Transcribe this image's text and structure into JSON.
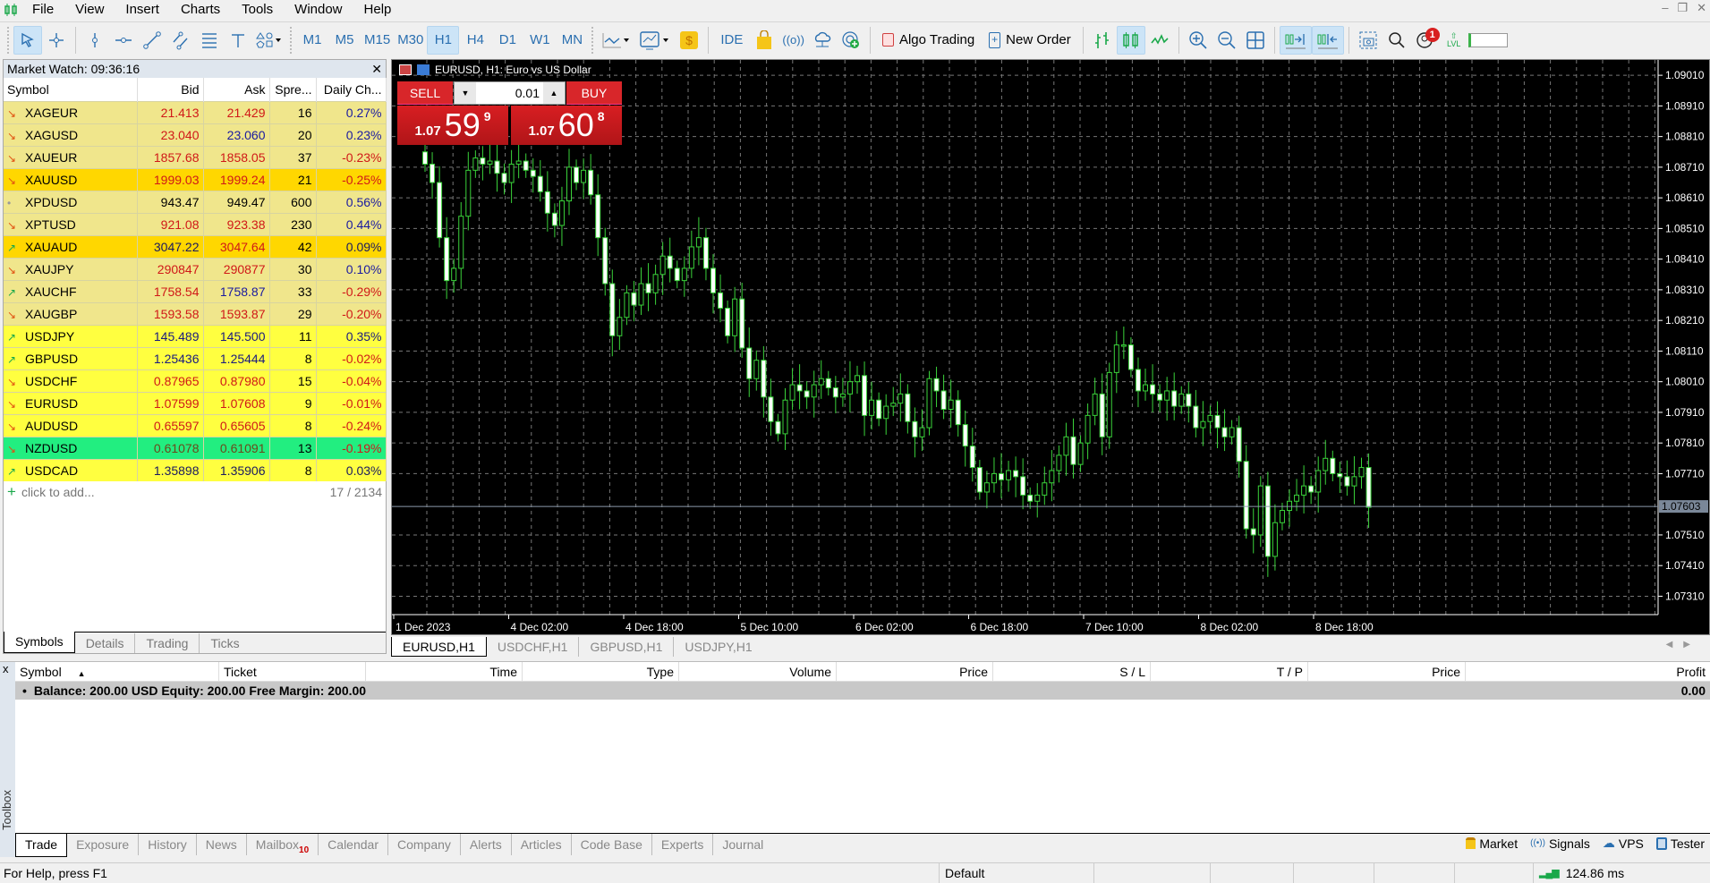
{
  "app": {
    "logo": "candles-logo"
  },
  "menu": [
    "File",
    "View",
    "Insert",
    "Charts",
    "Tools",
    "Window",
    "Help"
  ],
  "window_controls": {
    "minimize": "–",
    "restore": "❐",
    "close": "✕"
  },
  "toolbar": {
    "timeframes": [
      "M1",
      "M5",
      "M15",
      "M30",
      "H1",
      "H4",
      "D1",
      "W1",
      "MN"
    ],
    "active_timeframe": "H1",
    "ide_label": "IDE",
    "algo_trading_label": "Algo Trading",
    "new_order_label": "New Order",
    "notification_count": "1",
    "lvl_label": "LVL"
  },
  "market_watch": {
    "title": "Market Watch: 09:36:16",
    "columns": [
      "Symbol",
      "Bid",
      "Ask",
      "Spre...",
      "Daily Ch..."
    ],
    "rows": [
      {
        "symbol": "XAGEUR",
        "dir": "down",
        "bid": "21.413",
        "ask": "21.429",
        "spread": "16",
        "change": "0.27%",
        "bg": "#f0e68c",
        "bidColor": "#d01818",
        "askColor": "#d01818",
        "chgColor": "#1a1aa0"
      },
      {
        "symbol": "XAGUSD",
        "dir": "down",
        "bid": "23.040",
        "ask": "23.060",
        "spread": "20",
        "change": "0.23%",
        "bg": "#f0e68c",
        "bidColor": "#d01818",
        "askColor": "#1a1aa0",
        "chgColor": "#1a1aa0"
      },
      {
        "symbol": "XAUEUR",
        "dir": "down",
        "bid": "1857.68",
        "ask": "1858.05",
        "spread": "37",
        "change": "-0.23%",
        "bg": "#f0e68c",
        "bidColor": "#d01818",
        "askColor": "#d01818",
        "chgColor": "#d01818"
      },
      {
        "symbol": "XAUUSD",
        "dir": "down",
        "bid": "1999.03",
        "ask": "1999.24",
        "spread": "21",
        "change": "-0.25%",
        "bg": "#ffd700",
        "bidColor": "#d01818",
        "askColor": "#d01818",
        "chgColor": "#d01818"
      },
      {
        "symbol": "XPDUSD",
        "dir": "none",
        "bid": "943.47",
        "ask": "949.47",
        "spread": "600",
        "change": "0.56%",
        "bg": "#f0e68c",
        "bidColor": "#000000",
        "askColor": "#000000",
        "chgColor": "#1a1aa0"
      },
      {
        "symbol": "XPTUSD",
        "dir": "down",
        "bid": "921.08",
        "ask": "923.38",
        "spread": "230",
        "change": "0.44%",
        "bg": "#f0e68c",
        "bidColor": "#d01818",
        "askColor": "#d01818",
        "chgColor": "#1a1aa0"
      },
      {
        "symbol": "XAUAUD",
        "dir": "up",
        "bid": "3047.22",
        "ask": "3047.64",
        "spread": "42",
        "change": "0.09%",
        "bg": "#ffd700",
        "bidColor": "#1a1a60",
        "askColor": "#d01818",
        "chgColor": "#1a1a60"
      },
      {
        "symbol": "XAUJPY",
        "dir": "down",
        "bid": "290847",
        "ask": "290877",
        "spread": "30",
        "change": "0.10%",
        "bg": "#f0e68c",
        "bidColor": "#d01818",
        "askColor": "#d01818",
        "chgColor": "#1a1aa0"
      },
      {
        "symbol": "XAUCHF",
        "dir": "up",
        "bid": "1758.54",
        "ask": "1758.87",
        "spread": "33",
        "change": "-0.29%",
        "bg": "#f0e68c",
        "bidColor": "#d01818",
        "askColor": "#1a1aa0",
        "chgColor": "#d01818"
      },
      {
        "symbol": "XAUGBP",
        "dir": "down",
        "bid": "1593.58",
        "ask": "1593.87",
        "spread": "29",
        "change": "-0.20%",
        "bg": "#f0e68c",
        "bidColor": "#d01818",
        "askColor": "#d01818",
        "chgColor": "#d01818"
      },
      {
        "symbol": "USDJPY",
        "dir": "up",
        "bid": "145.489",
        "ask": "145.500",
        "spread": "11",
        "change": "0.35%",
        "bg": "#ffff40",
        "bidColor": "#1a1a80",
        "askColor": "#1a1a80",
        "chgColor": "#1a1a80"
      },
      {
        "symbol": "GBPUSD",
        "dir": "up",
        "bid": "1.25436",
        "ask": "1.25444",
        "spread": "8",
        "change": "-0.02%",
        "bg": "#ffff40",
        "bidColor": "#1a1a80",
        "askColor": "#1a1a80",
        "chgColor": "#d01818"
      },
      {
        "symbol": "USDCHF",
        "dir": "down",
        "bid": "0.87965",
        "ask": "0.87980",
        "spread": "15",
        "change": "-0.04%",
        "bg": "#ffff40",
        "bidColor": "#d01818",
        "askColor": "#d01818",
        "chgColor": "#d01818"
      },
      {
        "symbol": "EURUSD",
        "dir": "down",
        "bid": "1.07599",
        "ask": "1.07608",
        "spread": "9",
        "change": "-0.01%",
        "bg": "#ffff40",
        "bidColor": "#d01818",
        "askColor": "#d01818",
        "chgColor": "#d01818"
      },
      {
        "symbol": "AUDUSD",
        "dir": "down",
        "bid": "0.65597",
        "ask": "0.65605",
        "spread": "8",
        "change": "-0.24%",
        "bg": "#ffff40",
        "bidColor": "#d01818",
        "askColor": "#d01818",
        "chgColor": "#d01818"
      },
      {
        "symbol": "NZDUSD",
        "dir": "down",
        "bid": "0.61078",
        "ask": "0.61091",
        "spread": "13",
        "change": "-0.19%",
        "bg": "#22ee80",
        "bidColor": "#6a4a1a",
        "askColor": "#6a4a1a",
        "chgColor": "#d01818"
      },
      {
        "symbol": "USDCAD",
        "dir": "up",
        "bid": "1.35898",
        "ask": "1.35906",
        "spread": "8",
        "change": "0.03%",
        "bg": "#ffff40",
        "bidColor": "#1a1a60",
        "askColor": "#1a1a60",
        "chgColor": "#1a1a60"
      }
    ],
    "add_label": "click to add...",
    "count": "17 / 2134",
    "tabs": [
      "Symbols",
      "Details",
      "Trading",
      "Ticks"
    ],
    "active_tab": "Symbols"
  },
  "chart": {
    "title": "EURUSD, H1:  Euro vs US Dollar",
    "one_click": {
      "sell_label": "SELL",
      "buy_label": "BUY",
      "volume": "0.01",
      "sell_prefix": "1.07",
      "sell_big": "59",
      "sell_sup": "9",
      "buy_prefix": "1.07",
      "buy_big": "60",
      "buy_sup": "8"
    },
    "tabs": [
      "EURUSD,H1",
      "USDCHF,H1",
      "GBPUSD,H1",
      "USDJPY,H1"
    ],
    "active_tab": "EURUSD,H1"
  },
  "chart_data": {
    "type": "candlestick",
    "symbol": "EURUSD",
    "timeframe": "H1",
    "title": "EURUSD, H1: Euro vs US Dollar",
    "ylim": [
      1.0725,
      1.0906
    ],
    "y_ticks": [
      "1.09010",
      "1.08910",
      "1.08810",
      "1.08710",
      "1.08610",
      "1.08510",
      "1.08410",
      "1.08310",
      "1.08210",
      "1.08110",
      "1.08010",
      "1.07910",
      "1.07810",
      "1.07710",
      "1.07510",
      "1.07410",
      "1.07310"
    ],
    "x_ticks": [
      "1 Dec 2023",
      "4 Dec 02:00",
      "4 Dec 18:00",
      "5 Dec 10:00",
      "6 Dec 02:00",
      "6 Dec 18:00",
      "7 Dec 10:00",
      "8 Dec 02:00",
      "8 Dec 18:00"
    ],
    "current_price": "1.07603",
    "grid": true,
    "closes": [
      1.0872,
      1.0866,
      1.0848,
      1.0834,
      1.0838,
      1.0855,
      1.087,
      1.0874,
      1.0872,
      1.0873,
      1.0869,
      1.0866,
      1.0872,
      1.0873,
      1.087,
      1.0868,
      1.0863,
      1.0856,
      1.0852,
      1.086,
      1.0871,
      1.0866,
      1.087,
      1.0862,
      1.0848,
      1.0833,
      1.0816,
      1.0822,
      1.083,
      1.0826,
      1.0833,
      1.083,
      1.0836,
      1.0842,
      1.0838,
      1.0834,
      1.0838,
      1.0845,
      1.0848,
      1.0838,
      1.083,
      1.0825,
      1.0816,
      1.0828,
      1.0812,
      1.0802,
      1.0808,
      1.0796,
      1.0788,
      1.0784,
      1.0795,
      1.08,
      1.0798,
      1.0796,
      1.08,
      1.0802,
      1.0799,
      1.0796,
      1.0797,
      1.0801,
      1.0803,
      1.079,
      1.0795,
      1.0789,
      1.0793,
      1.0794,
      1.0797,
      1.0788,
      1.0783,
      1.0786,
      1.0802,
      1.0798,
      1.0792,
      1.0795,
      1.0787,
      1.078,
      1.0773,
      1.0765,
      1.0768,
      1.0771,
      1.0769,
      1.0772,
      1.077,
      1.0764,
      1.0762,
      1.0764,
      1.0768,
      1.0772,
      1.0777,
      1.0783,
      1.0774,
      1.0781,
      1.079,
      1.0797,
      1.0783,
      1.0804,
      1.0813,
      1.0813,
      1.0805,
      1.0798,
      1.08,
      1.0797,
      1.0795,
      1.0798,
      1.0793,
      1.0797,
      1.0793,
      1.0786,
      1.0788,
      1.079,
      1.0786,
      1.0783,
      1.0786,
      1.0775,
      1.0753,
      1.0751,
      1.0767,
      1.0744,
      1.0755,
      1.0759,
      1.0762,
      1.0764,
      1.0767,
      1.0765,
      1.0772,
      1.0776,
      1.0771,
      1.077,
      1.0767,
      1.077,
      1.0773,
      1.076
    ]
  },
  "toolbox": {
    "close_label": "x",
    "side_label": "Toolbox",
    "columns": [
      "Symbol",
      "Ticket",
      "Time",
      "Type",
      "Volume",
      "Price",
      "S / L",
      "T / P",
      "Price",
      "Profit"
    ],
    "balance_text": "Balance: 200.00 USD  Equity: 200.00  Free Margin: 200.00",
    "profit_total": "0.00",
    "tabs": [
      "Trade",
      "Exposure",
      "History",
      "News",
      "Mailbox",
      "Calendar",
      "Company",
      "Alerts",
      "Articles",
      "Code Base",
      "Experts",
      "Journal"
    ],
    "active_tab": "Trade",
    "mailbox_count": "10",
    "services": [
      "Market",
      "Signals",
      "VPS",
      "Tester"
    ]
  },
  "statusbar": {
    "help": "For Help, press F1",
    "profile": "Default",
    "ping": "124.86 ms"
  }
}
